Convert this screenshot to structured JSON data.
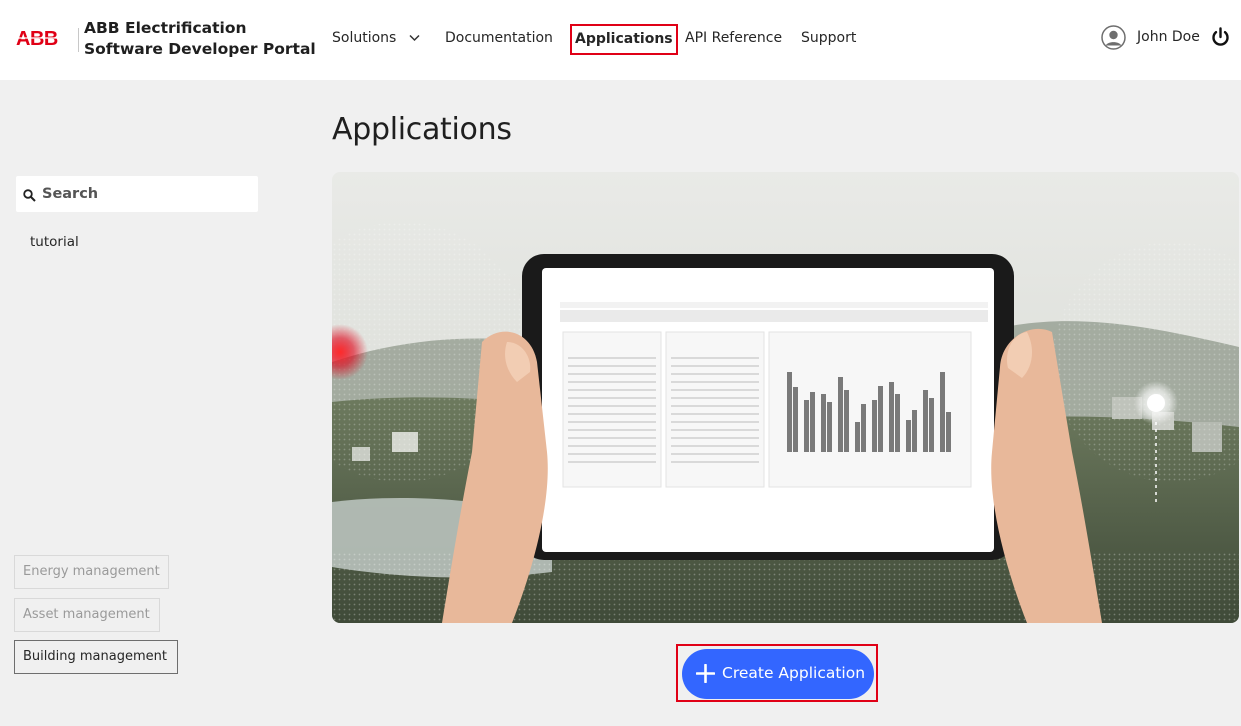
{
  "header": {
    "brand": "ABB",
    "portal_title_line1": "ABB Electrification",
    "portal_title_line2": "Software Developer Portal",
    "nav": {
      "solutions": "Solutions",
      "documentation": "Documentation",
      "applications": "Applications",
      "api_reference": "API Reference",
      "support": "Support"
    },
    "user_name": "John Doe"
  },
  "sidebar": {
    "search_placeholder": "Search",
    "tag": "tutorial",
    "filters": [
      "Energy management",
      "Asset management",
      "Building management"
    ],
    "active_filter": "Building management"
  },
  "main": {
    "page_title": "Applications",
    "create_button_label": "Create Application"
  },
  "colors": {
    "brand_red": "#e00016",
    "primary_blue": "#3366ff",
    "background": "#f0f0f0"
  }
}
